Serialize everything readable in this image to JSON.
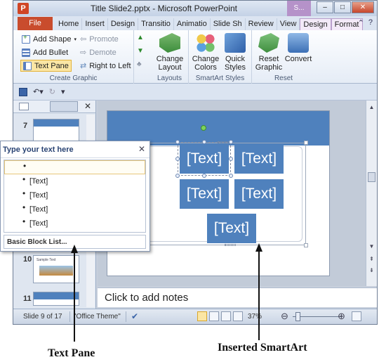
{
  "window": {
    "title": "Title Slide2.pptx - Microsoft PowerPoint",
    "app_icon": "P",
    "context_header": "S...",
    "controls": [
      "–",
      "□",
      "✕"
    ]
  },
  "tabs": {
    "file": "File",
    "items": [
      "Home",
      "Insert",
      "Design",
      "Transitio",
      "Animatio",
      "Slide Sh",
      "Review",
      "View",
      "Design",
      "Format"
    ],
    "active_index": 8,
    "help_icons": [
      "help-icon"
    ]
  },
  "ribbon": {
    "create_graphic": {
      "label": "Create Graphic",
      "add_shape": "Add Shape",
      "add_bullet": "Add Bullet",
      "text_pane": "Text Pane",
      "promote": "Promote",
      "demote": "Demote",
      "right_to_left": "Right to Left"
    },
    "layouts": {
      "label": "Layouts",
      "change_layout": "Change Layout"
    },
    "smartart_styles": {
      "label": "SmartArt Styles",
      "change_colors": "Change Colors",
      "quick_styles": "Quick Styles"
    },
    "reset": {
      "label": "Reset",
      "reset_graphic": "Reset Graphic",
      "convert": "Convert"
    }
  },
  "thumbnails": {
    "slides": [
      {
        "num": "7"
      },
      {
        "num": "10",
        "caption": "Sample Text"
      },
      {
        "num": "11"
      }
    ]
  },
  "slide": {
    "blocks": [
      "[Text]",
      "[Text]",
      "[Text]",
      "[Text]",
      "[Text]"
    ]
  },
  "notes": {
    "placeholder": "Click to add notes"
  },
  "status": {
    "slide_info": "Slide 9 of 17",
    "theme": "\"Office Theme\"",
    "zoom": "37%"
  },
  "text_pane": {
    "title": "Type your text here",
    "items": [
      "",
      "[Text]",
      "[Text]",
      "[Text]",
      "[Text]"
    ],
    "footer": "Basic Block List..."
  },
  "callouts": {
    "text_pane": "Text Pane",
    "smartart": "Inserted SmartArt"
  },
  "colors": {
    "accent_blue": "#4f81bd",
    "file_tab": "#c94c2d",
    "context_purple": "#b592c9"
  }
}
